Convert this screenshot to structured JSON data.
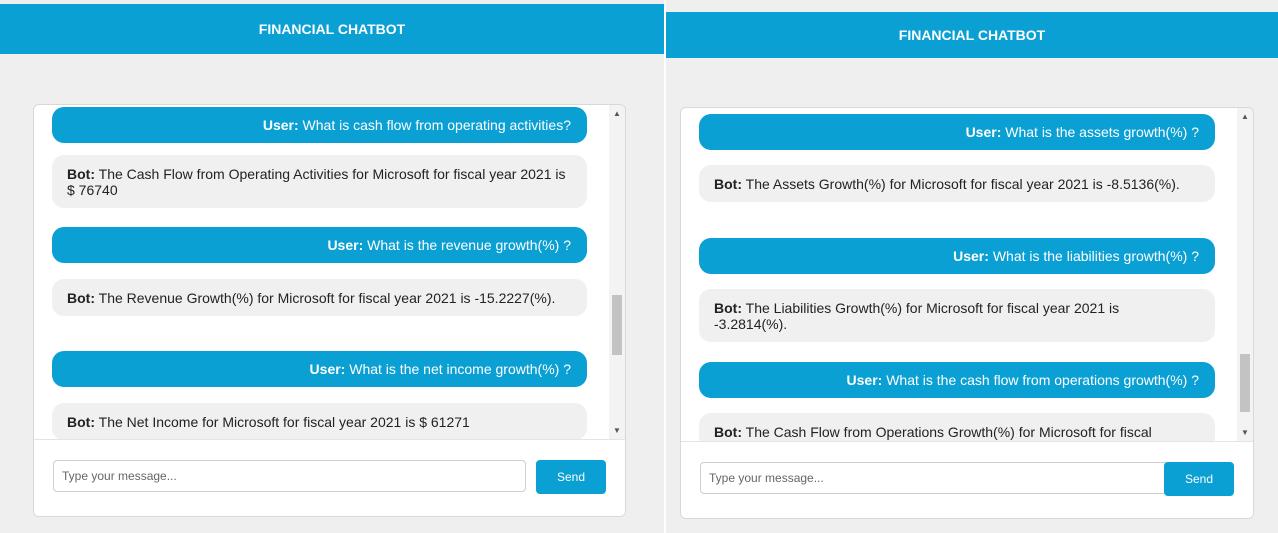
{
  "panels": [
    {
      "header": "FINANCIAL CHATBOT",
      "messages": [
        {
          "role": "user",
          "speaker": "User:",
          "text": "What is cash flow from operating activities?"
        },
        {
          "role": "bot",
          "speaker": "Bot:",
          "text": "The Cash Flow from Operating Activities for Microsoft for fiscal year 2021 is $ 76740"
        },
        {
          "role": "user",
          "speaker": "User:",
          "text": "What is the revenue growth(%) ?"
        },
        {
          "role": "bot",
          "speaker": "Bot:",
          "text": "The Revenue Growth(%) for Microsoft for fiscal year 2021 is -15.2227(%)."
        },
        {
          "role": "user",
          "speaker": "User:",
          "text": "What is the net income growth(%) ?"
        },
        {
          "role": "bot",
          "speaker": "Bot:",
          "text": "The Net Income for Microsoft for fiscal year 2021 is $ 61271"
        }
      ],
      "input_placeholder": "Type your message...",
      "send_label": "Send"
    },
    {
      "header": "FINANCIAL CHATBOT",
      "messages": [
        {
          "role": "user",
          "speaker": "User:",
          "text": "What is the assets growth(%) ?"
        },
        {
          "role": "bot",
          "speaker": "Bot:",
          "text": "The Assets Growth(%) for Microsoft for fiscal year 2021 is -8.5136(%)."
        },
        {
          "role": "user",
          "speaker": "User:",
          "text": "What is the liabilities growth(%) ?"
        },
        {
          "role": "bot",
          "speaker": "Bot:",
          "text": "The Liabilities Growth(%) for Microsoft for fiscal year 2021 is -3.2814(%)."
        },
        {
          "role": "user",
          "speaker": "User:",
          "text": "What is the cash flow from operations growth(%) ?"
        },
        {
          "role": "bot",
          "speaker": "Bot:",
          "text": "The Cash Flow from Operations Growth(%) for Microsoft for fiscal"
        }
      ],
      "input_placeholder": "Type your message...",
      "send_label": "Send"
    }
  ],
  "colors": {
    "accent": "#0aa0d4",
    "page_bg": "#efefef",
    "bot_bubble": "#f0f0f0"
  }
}
